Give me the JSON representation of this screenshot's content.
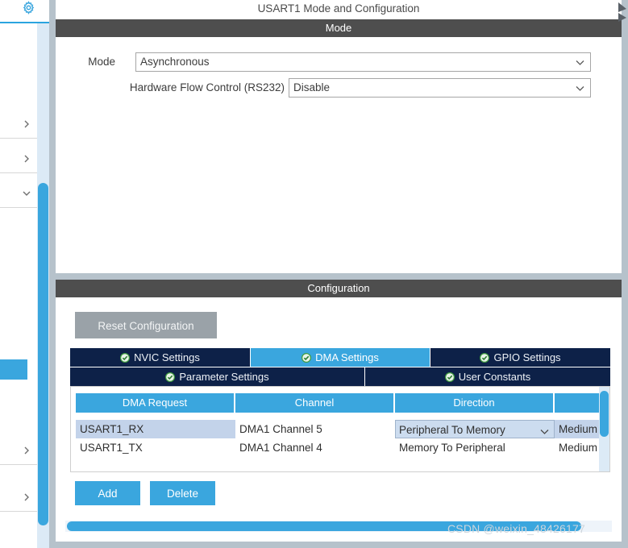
{
  "window": {
    "pane_title": "USART1 Mode and Configuration",
    "edge_handle_icon": "chevron-right-icon"
  },
  "sidebar": {
    "gear_icon": "gear-icon",
    "rows": [
      {
        "icon": "chevron-right-icon"
      },
      {
        "icon": "chevron-right-icon"
      },
      {
        "icon": "chevron-down-icon"
      },
      {
        "icon": "chevron-right-icon"
      },
      {
        "icon": "chevron-right-icon"
      }
    ]
  },
  "mode_panel": {
    "header": "Mode",
    "fields": [
      {
        "label": "Mode",
        "value": "Asynchronous",
        "caret_icon": "chevron-down-icon"
      },
      {
        "label": "Hardware Flow Control (RS232)",
        "value": "Disable",
        "caret_icon": "chevron-down-icon"
      }
    ]
  },
  "config_panel": {
    "header": "Configuration",
    "reset_label": "Reset Configuration",
    "tabs_row1": [
      {
        "label": "NVIC Settings",
        "active": false,
        "icon": "check-circle-icon"
      },
      {
        "label": "DMA Settings",
        "active": true,
        "icon": "check-circle-icon"
      },
      {
        "label": "GPIO Settings",
        "active": false,
        "icon": "check-circle-icon"
      }
    ],
    "tabs_row2": [
      {
        "label": "Parameter Settings",
        "active": false,
        "icon": "check-circle-icon"
      },
      {
        "label": "User Constants",
        "active": false,
        "icon": "check-circle-icon"
      }
    ],
    "table": {
      "columns": [
        "DMA Request",
        "Channel",
        "Direction",
        ""
      ],
      "rows": [
        {
          "dma_request": "USART1_RX",
          "channel": "DMA1 Channel 5",
          "direction": "Peripheral To Memory",
          "priority": "Medium",
          "direction_caret_icon": "chevron-down-icon"
        },
        {
          "dma_request": "USART1_TX",
          "channel": "DMA1 Channel 4",
          "direction": "Memory To Peripheral",
          "priority": "Medium"
        }
      ]
    },
    "add_label": "Add",
    "delete_label": "Delete"
  },
  "watermark": "CSDN @weixin_48426177",
  "colors": {
    "accent_blue": "#3aa6de",
    "tab_navy": "#0d2148",
    "group_header_gray": "#4e4e4e",
    "frame_gray": "#b6c2cb",
    "disabled_button": "#9aa2a8",
    "check_green": "#3f9c3f",
    "row_selected": "#c3d3ea"
  }
}
